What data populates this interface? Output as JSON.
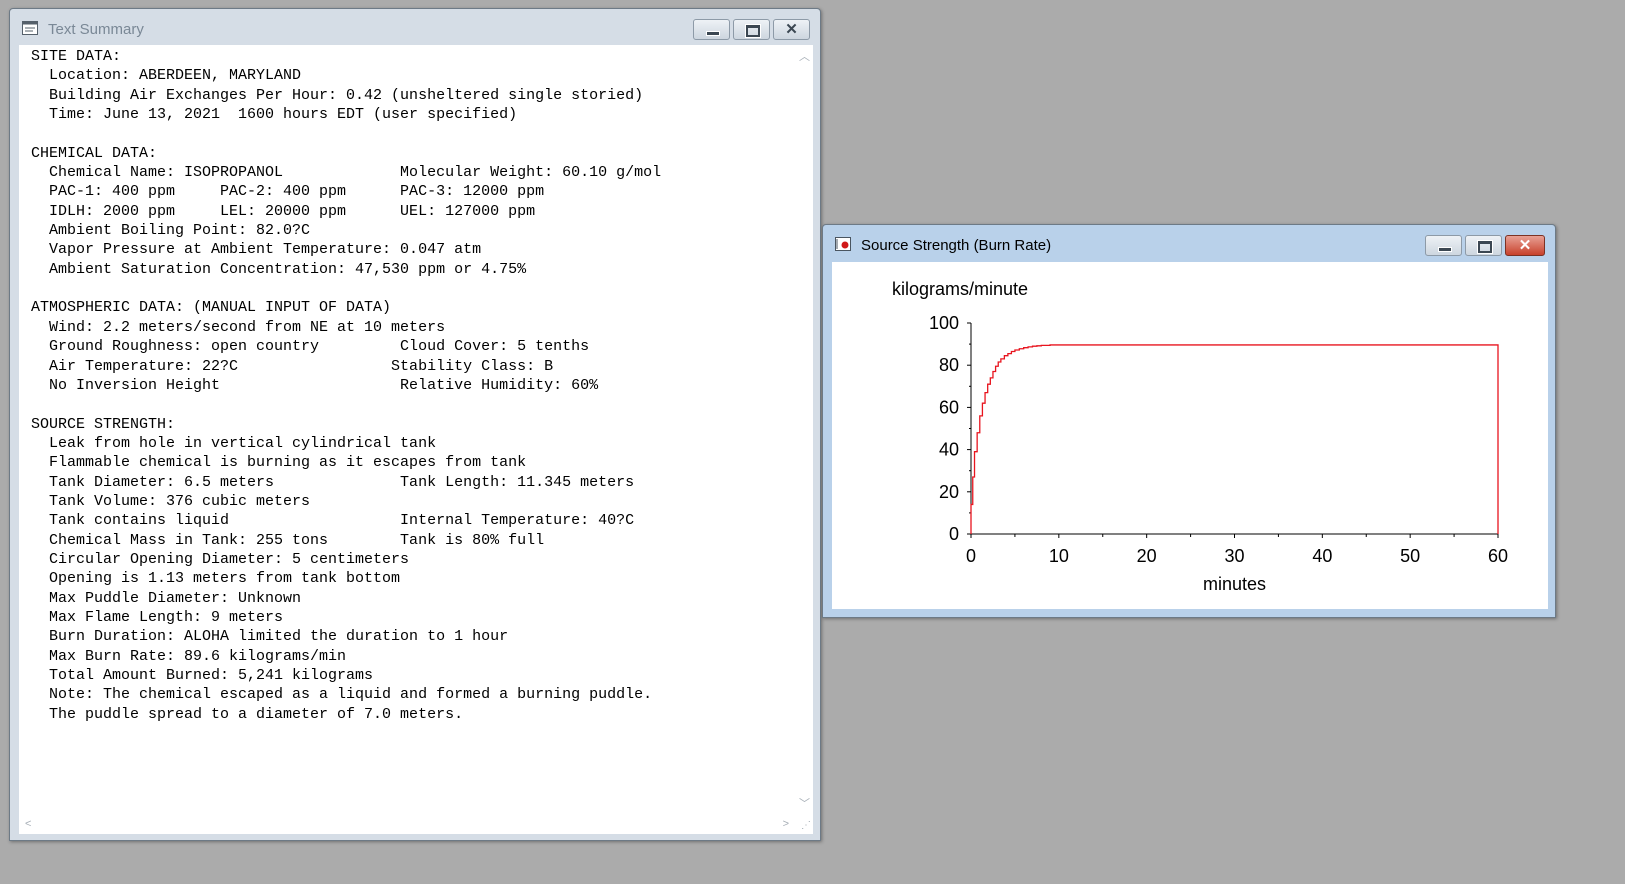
{
  "text_window": {
    "title": "Text Summary",
    "lines": [
      "SITE DATA:",
      "  Location: ABERDEEN, MARYLAND",
      "  Building Air Exchanges Per Hour: 0.42 (unsheltered single storied)",
      "  Time: June 13, 2021  1600 hours EDT (user specified)",
      "",
      "CHEMICAL DATA:",
      "  Chemical Name: ISOPROPANOL             Molecular Weight: 60.10 g/mol",
      "  PAC-1: 400 ppm     PAC-2: 400 ppm      PAC-3: 12000 ppm",
      "  IDLH: 2000 ppm     LEL: 20000 ppm      UEL: 127000 ppm",
      "  Ambient Boiling Point: 82.0?C",
      "  Vapor Pressure at Ambient Temperature: 0.047 atm",
      "  Ambient Saturation Concentration: 47,530 ppm or 4.75%",
      "",
      "ATMOSPHERIC DATA: (MANUAL INPUT OF DATA)",
      "  Wind: 2.2 meters/second from NE at 10 meters",
      "  Ground Roughness: open country         Cloud Cover: 5 tenths",
      "  Air Temperature: 22?C                 Stability Class: B",
      "  No Inversion Height                    Relative Humidity: 60%",
      "",
      "SOURCE STRENGTH:",
      "  Leak from hole in vertical cylindrical tank",
      "  Flammable chemical is burning as it escapes from tank",
      "  Tank Diameter: 6.5 meters              Tank Length: 11.345 meters",
      "  Tank Volume: 376 cubic meters",
      "  Tank contains liquid                   Internal Temperature: 40?C",
      "  Chemical Mass in Tank: 255 tons        Tank is 80% full",
      "  Circular Opening Diameter: 5 centimeters",
      "  Opening is 1.13 meters from tank bottom",
      "  Max Puddle Diameter: Unknown",
      "  Max Flame Length: 9 meters",
      "  Burn Duration: ALOHA limited the duration to 1 hour",
      "  Max Burn Rate: 89.6 kilograms/min",
      "  Total Amount Burned: 5,241 kilograms",
      "  Note: The chemical escaped as a liquid and formed a burning puddle.",
      "  The puddle spread to a diameter of 7.0 meters."
    ]
  },
  "graph_window": {
    "title": "Source Strength (Burn Rate)"
  },
  "chart_data": {
    "type": "line",
    "step": true,
    "ylabel": "kilograms/minute",
    "xlabel": "minutes",
    "xlim": [
      0,
      60
    ],
    "ylim": [
      0,
      100
    ],
    "x_ticks": [
      "0",
      "10",
      "20",
      "30",
      "40",
      "50",
      "60"
    ],
    "y_ticks": [
      "0",
      "20",
      "40",
      "60",
      "80",
      "100"
    ],
    "grid": false,
    "series_color": "#e8141e",
    "series": [
      {
        "x": [
          0,
          0.2,
          0.4,
          0.7,
          1.0,
          1.3,
          1.6,
          1.9,
          2.2,
          2.5,
          2.8,
          3.1,
          3.4,
          3.8,
          4.2,
          4.6,
          5.0,
          5.5,
          6.0,
          6.5,
          7.0,
          7.5,
          8.0,
          9.0,
          60
        ],
        "y": [
          14,
          27,
          39,
          48,
          56,
          62,
          67,
          71,
          74,
          77,
          79.5,
          81.5,
          83,
          84.5,
          85.5,
          86.5,
          87.2,
          87.8,
          88.3,
          88.7,
          89,
          89.2,
          89.4,
          89.6,
          89.6
        ]
      }
    ]
  }
}
